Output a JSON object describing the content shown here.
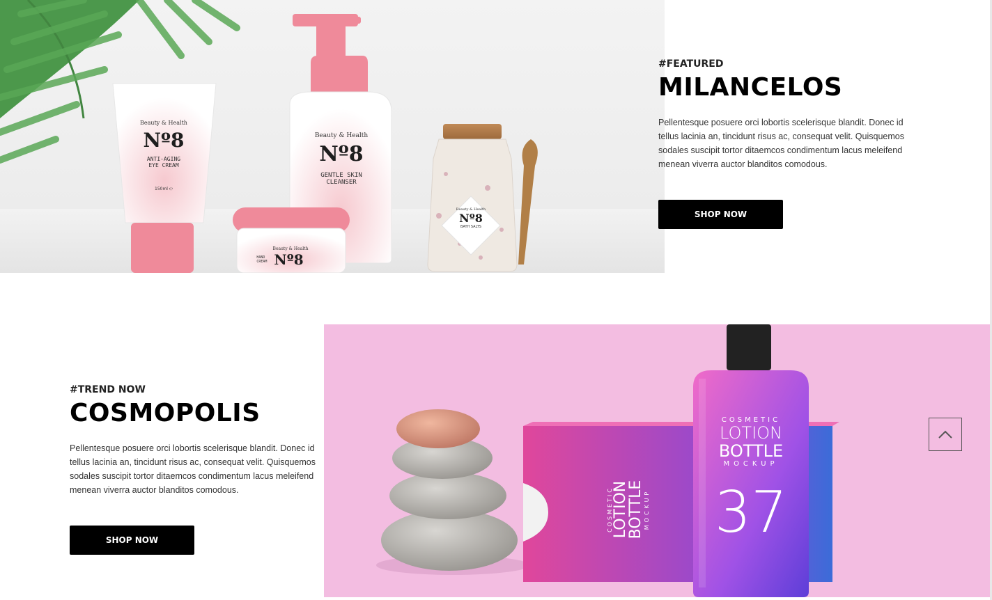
{
  "featured": {
    "eyebrow": "#FEATURED",
    "title": "MILANCELOS",
    "description": "Pellentesque posuere orci lobortis scelerisque blandit. Donec id tellus lacinia an, tincidunt risus ac, consequat velit. Quisquemos sodales suscipit tortor ditaemcos condimentum lacus meleifend menean viverra auctor blanditos comodous.",
    "button": "SHOP NOW",
    "image": {
      "tube_brand": "Beauty & Health",
      "tube_number": "Nº8",
      "tube_label_1": "ANTI-AGING",
      "tube_label_2": "EYE CREAM",
      "tube_size": "150ml ℮",
      "bottle_brand": "Beauty & Health",
      "bottle_number": "Nº8",
      "bottle_label_1": "GENTLE SKIN",
      "bottle_label_2": "CLEANSER",
      "jar_brand": "Beauty & Health",
      "jar_number": "Nº8",
      "jar_label_1": "HAND",
      "jar_label_2": "CREAM",
      "salts_brand": "Beauty & Health",
      "salts_number": "Nº8",
      "salts_label": "BATH SALTS"
    }
  },
  "trend": {
    "eyebrow": "#TREND NOW",
    "title": "COSMOPOLIS",
    "description": "Pellentesque posuere orci lobortis scelerisque blandit. Donec id tellus lacinia an, tincidunt risus ac, consequat velit. Quisquemos sodales suscipit tortor ditaemcos condimentum lacus meleifend menean viverra auctor blanditos comodous.",
    "button": "SHOP NOW",
    "image": {
      "bottle_line1": "COSMETIC",
      "bottle_line2": "LOTION",
      "bottle_line3": "BOTTLE",
      "bottle_line4": "MOCKUP",
      "bottle_number": "37",
      "box_line1": "COSMETIC",
      "box_line2": "LOTION",
      "box_line3": "BOTTLE",
      "box_line4": "MOCKUP"
    }
  },
  "scroll_top_icon": "chevron-up-icon",
  "colors": {
    "button_bg": "#000000",
    "button_text": "#ffffff",
    "product_pink": "#ef8a9a",
    "trend_bg": "#f3bde1"
  }
}
